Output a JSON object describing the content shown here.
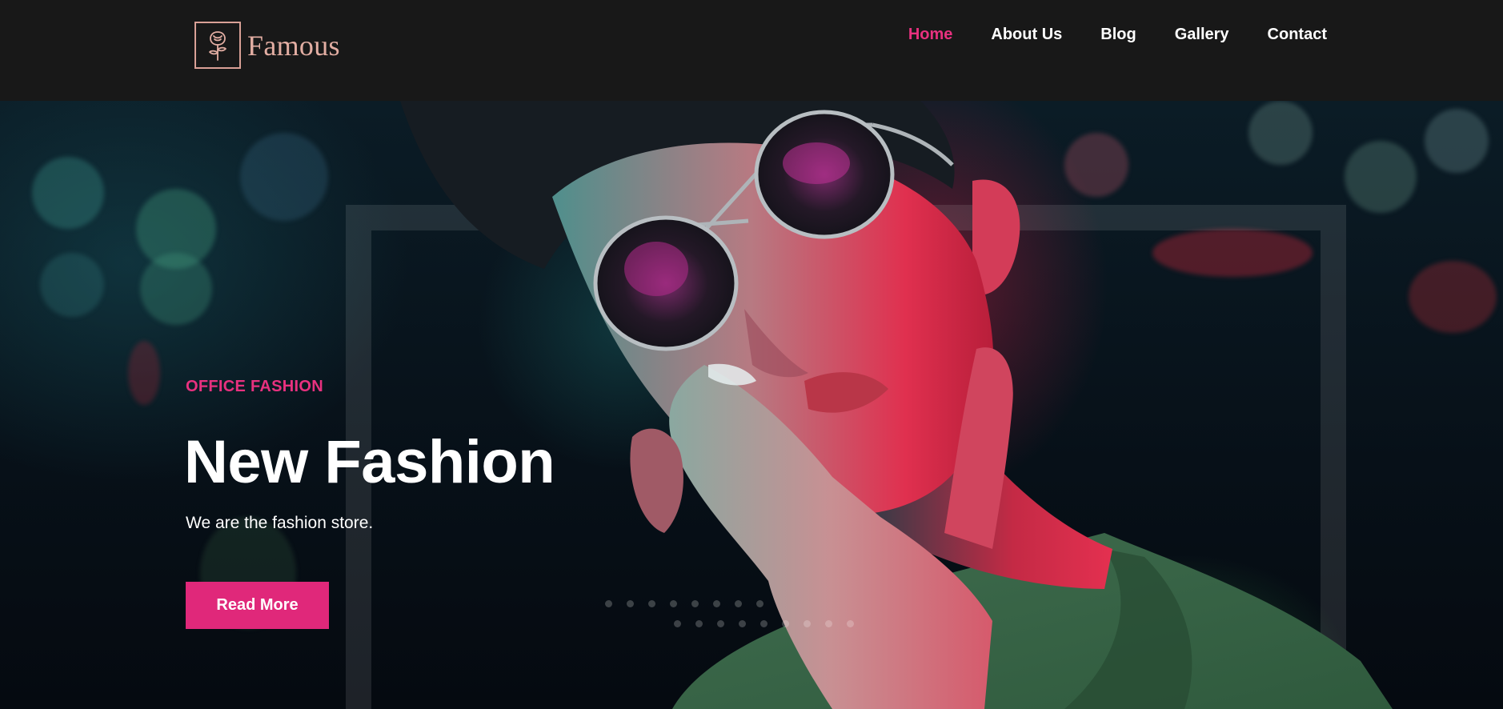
{
  "header": {
    "logo_text": "Famous",
    "logo_icon": "rose-icon",
    "nav": [
      {
        "label": "Home",
        "active": true
      },
      {
        "label": "About Us",
        "active": false
      },
      {
        "label": "Blog",
        "active": false
      },
      {
        "label": "Gallery",
        "active": false
      },
      {
        "label": "Contact",
        "active": false
      }
    ]
  },
  "hero": {
    "eyebrow": "OFFICE FASHION",
    "title": "New Fashion",
    "subtitle": "We are the fashion store.",
    "cta_label": "Read More"
  },
  "colors": {
    "accent": "#e0287a",
    "header_bg": "#181818",
    "logo": "#e3aea3"
  }
}
